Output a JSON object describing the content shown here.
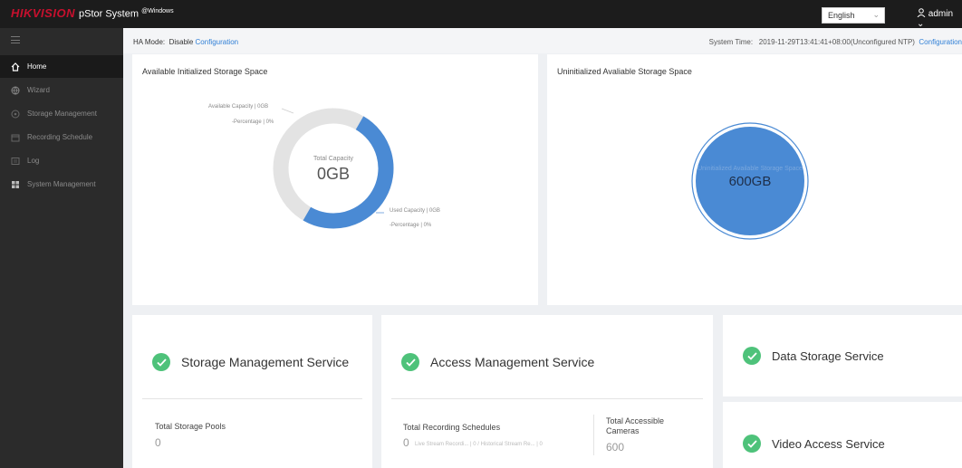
{
  "header": {
    "brand": "HIKVISION",
    "product": "pStor System",
    "edition": "@Windows",
    "language": "English",
    "user": "admin"
  },
  "sidebar": {
    "items": [
      {
        "label": "Home",
        "icon": "home-icon",
        "active": true
      },
      {
        "label": "Wizard",
        "icon": "globe-icon",
        "active": false
      },
      {
        "label": "Storage Management",
        "icon": "database-icon",
        "active": false
      },
      {
        "label": "Recording Schedule",
        "icon": "calendar-icon",
        "active": false
      },
      {
        "label": "Log",
        "icon": "log-icon",
        "active": false
      },
      {
        "label": "System Management",
        "icon": "grid-icon",
        "active": false
      }
    ]
  },
  "ha": {
    "label": "HA Mode:",
    "status": "Disable",
    "config_link": "Configuration",
    "time_label": "System Time:",
    "time_value": "2019-11-29T13:41:41+08:00(Unconfigured NTP)",
    "time_link": "Configuration"
  },
  "available_storage": {
    "title": "Available Initialized Storage Space",
    "center_label": "Total Capacity",
    "center_value": "0GB",
    "available_label": "Available Capacity | 0GB",
    "available_pct": "-Percentage | 0%",
    "used_label": "Used Capacity | 0GB",
    "used_pct": "-Percentage | 0%",
    "used_fraction": 0.5
  },
  "uninit_storage": {
    "title": "Uninitialized Avaliable Storage Space",
    "bubble_label": "Uninitialized Available Storage Space",
    "bubble_value": "600GB"
  },
  "services": {
    "storage": {
      "name": "Storage Management Service",
      "pools_label": "Total Storage Pools",
      "pools_value": "0"
    },
    "access": {
      "name": "Access Management Service",
      "schedules_label": "Total Recording Schedules",
      "schedules_value": "0",
      "schedules_note": "Live Stream Recordi... | 0 / Historical Stream Re... | 0",
      "cameras_label": "Total Accessible Cameras",
      "cameras_value": "600"
    },
    "data": {
      "name": "Data Storage Service"
    },
    "video": {
      "name": "Video Access Service"
    }
  },
  "colors": {
    "accent": "#2f7fd6",
    "ring_used": "#4a8ad4",
    "ring_available": "#e3e3e3",
    "ok": "#4ec27a"
  }
}
